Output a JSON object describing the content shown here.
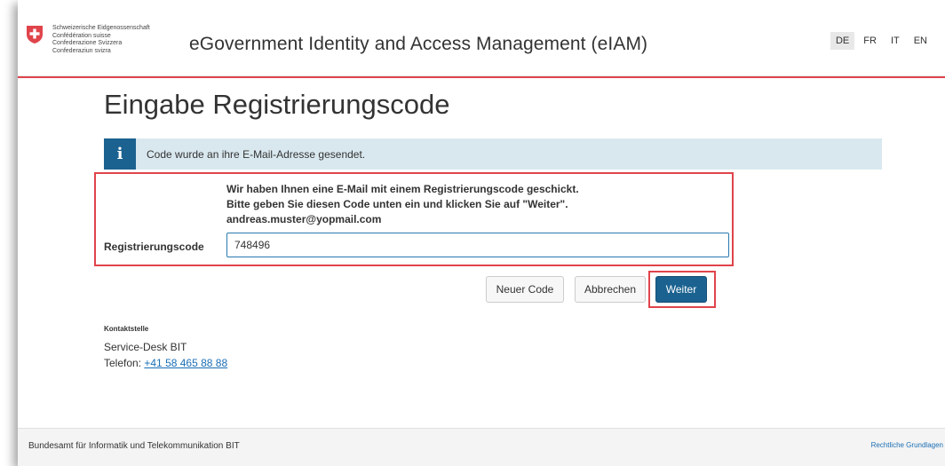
{
  "header": {
    "confederation_names": [
      "Schweizerische Eidgenossenschaft",
      "Confédération suisse",
      "Confederazione Svizzera",
      "Confederaziun svizra"
    ],
    "app_title": "eGovernment Identity and Access Management (eIAM)",
    "languages": [
      "DE",
      "FR",
      "IT",
      "EN"
    ],
    "active_language": "DE",
    "accent_color": "#e0444b"
  },
  "main": {
    "page_title": "Eingabe Registrierungscode",
    "alert": {
      "icon": "info-icon",
      "text": "Code wurde an ihre E-Mail-Adresse gesendet."
    },
    "instructions": [
      "Wir haben Ihnen eine E-Mail mit einem Registrierungscode geschickt.",
      "Bitte geben Sie diesen Code unten ein und klicken Sie auf \"Weiter\".",
      "andreas.muster@yopmail.com"
    ],
    "field_label": "Registrierungscode",
    "field_value": "748496",
    "buttons": {
      "new_code": "Neuer Code",
      "cancel": "Abbrechen",
      "next": "Weiter"
    },
    "primary_color": "#1b6290"
  },
  "contact": {
    "title": "Kontaktstelle",
    "service": "Service-Desk BIT",
    "phone_label": "Telefon: ",
    "phone": "+41 58 465 88 88"
  },
  "footer": {
    "left": "Bundesamt für Informatik und Telekommunikation BIT",
    "right": "Rechtliche Grundlagen"
  }
}
